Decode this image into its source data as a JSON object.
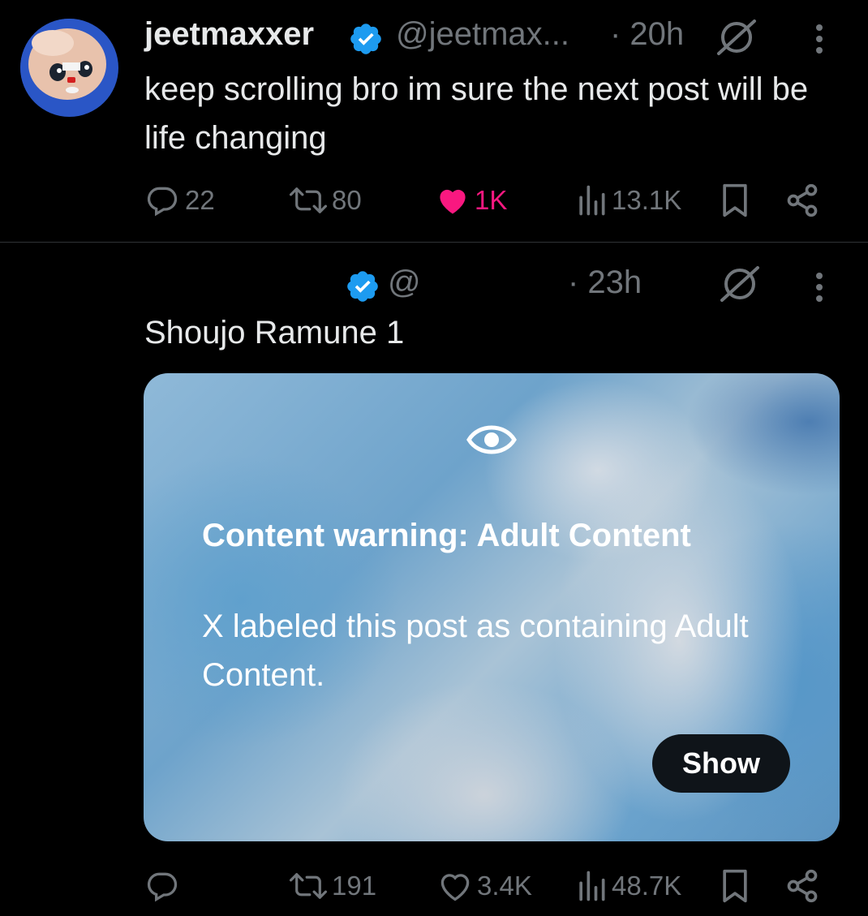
{
  "post1": {
    "display_name": "jeetmaxxer",
    "handle": "@jeetmax...",
    "time": "· 20h",
    "text": "keep scrolling bro im sure the next post will be life changing",
    "actions": {
      "replies": "22",
      "reposts": "80",
      "likes": "1K",
      "views": "13.1K"
    },
    "liked": true,
    "colors": {
      "like": "#f91880",
      "verified": "#1d9bf0"
    }
  },
  "post2": {
    "handle": "@",
    "time": "· 23h",
    "text": "Shoujo Ramune 1",
    "media_warning": {
      "title": "Content warning: Adult Content",
      "body": "X labeled this post as containing Adult Content.",
      "show_label": "Show"
    },
    "actions": {
      "replies": "",
      "reposts": "191",
      "likes": "3.4K",
      "views": "48.7K"
    }
  },
  "icons": [
    "verified-badge-icon",
    "grok-icon",
    "more-icon",
    "reply-icon",
    "repost-icon",
    "like-icon",
    "views-icon",
    "bookmark-icon",
    "share-icon",
    "eye-icon"
  ]
}
